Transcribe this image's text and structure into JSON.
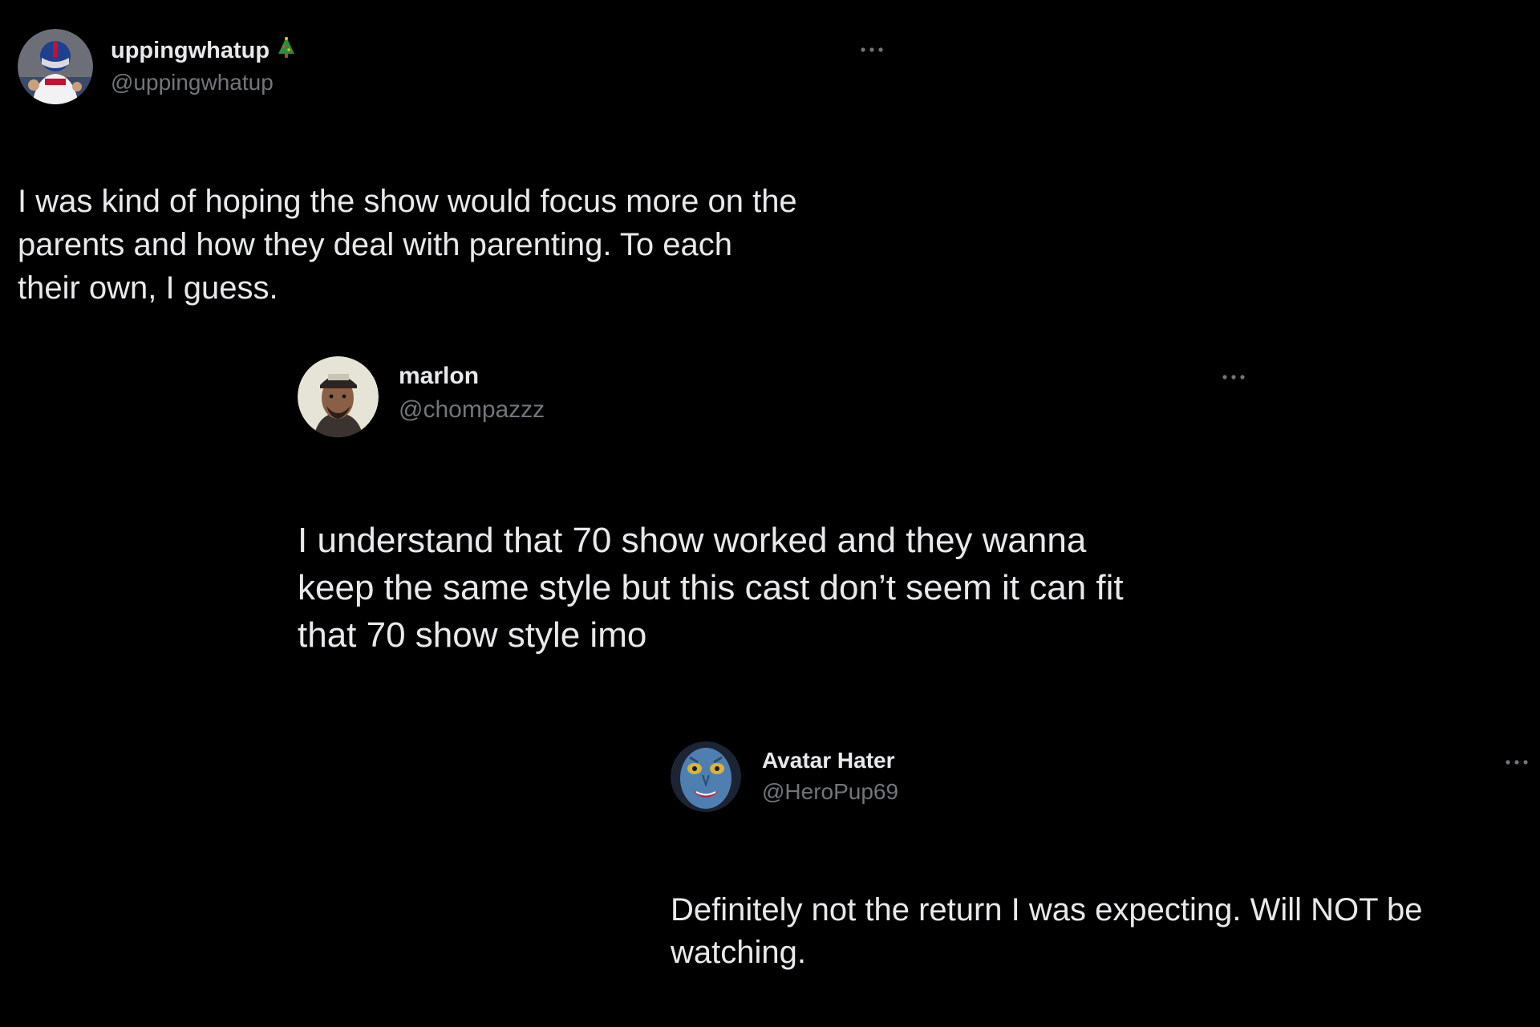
{
  "colors": {
    "background": "#000000",
    "text_primary": "#e7e9ea",
    "text_secondary": "#71767b"
  },
  "tweets": [
    {
      "display_name": "uppingwhatup",
      "display_name_badge": "christmas-tree-emoji",
      "handle": "@uppingwhatup",
      "avatar_icon": "football-player-avatar",
      "more_icon": "more-options-icon",
      "text": "I was kind of hoping the show would focus more on the\nparents and how they deal with parenting. To each\ntheir own, I guess."
    },
    {
      "display_name": "marlon",
      "handle": "@chompazzz",
      "avatar_icon": "person-cap-avatar",
      "more_icon": "more-options-icon",
      "text": "I understand that 70 show worked and they wanna\nkeep the same style but this cast don’t seem it can fit\nthat 70 show style imo"
    },
    {
      "display_name": "Avatar Hater",
      "handle": "@HeroPup69",
      "avatar_icon": "blue-face-avatar",
      "more_icon": "more-options-icon",
      "text": "Definitely not the return I was expecting. Will NOT be\nwatching."
    }
  ]
}
